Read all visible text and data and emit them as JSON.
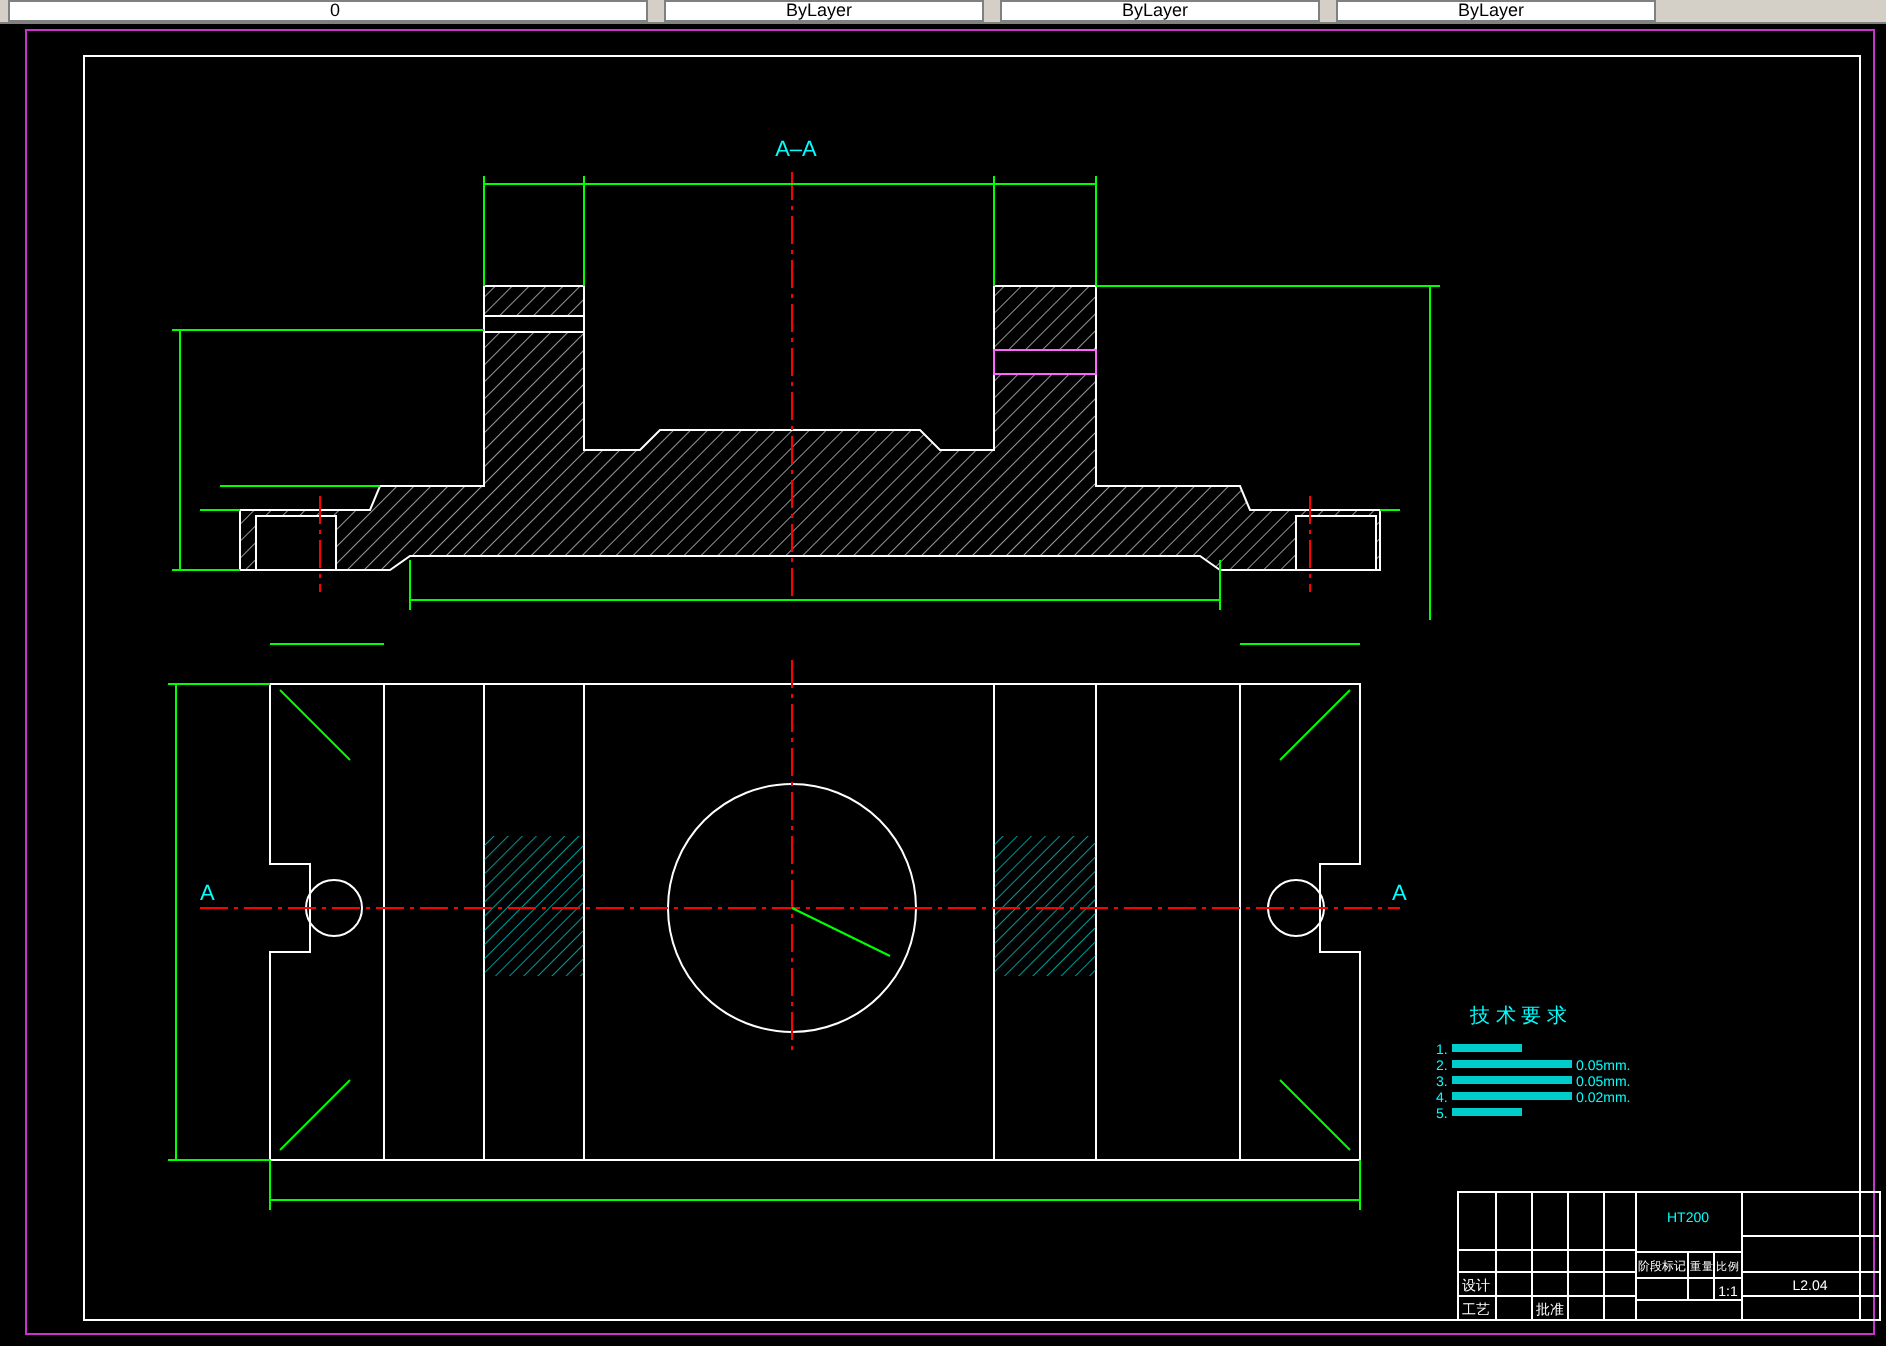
{
  "toolbar": {
    "layer": "0",
    "dropdowns": [
      "ByLayer",
      "ByLayer",
      "ByLayer"
    ]
  },
  "drawing": {
    "section_title": "A–A",
    "section_marks": [
      "A",
      "A"
    ]
  },
  "requirements": {
    "title": "技 术 要 求",
    "items": [
      {
        "number": "1."
      },
      {
        "number": "2.",
        "tail": "0.05mm."
      },
      {
        "number": "3.",
        "tail": "0.05mm."
      },
      {
        "number": "4.",
        "tail": "0.02mm."
      },
      {
        "number": "5."
      }
    ]
  },
  "title_block": {
    "material": "HT200",
    "drawing_number": "L2.04",
    "scale": "1:1",
    "labels": [
      {
        "text": "设计",
        "kind": "left"
      },
      {
        "text": "工艺",
        "kind": "left"
      },
      {
        "text": "批准",
        "kind": "mid"
      },
      {
        "text": "阶段标记",
        "kind": "stage"
      },
      {
        "text": "重量",
        "kind": "weight"
      },
      {
        "text": "比例",
        "kind": "scale"
      }
    ]
  }
}
